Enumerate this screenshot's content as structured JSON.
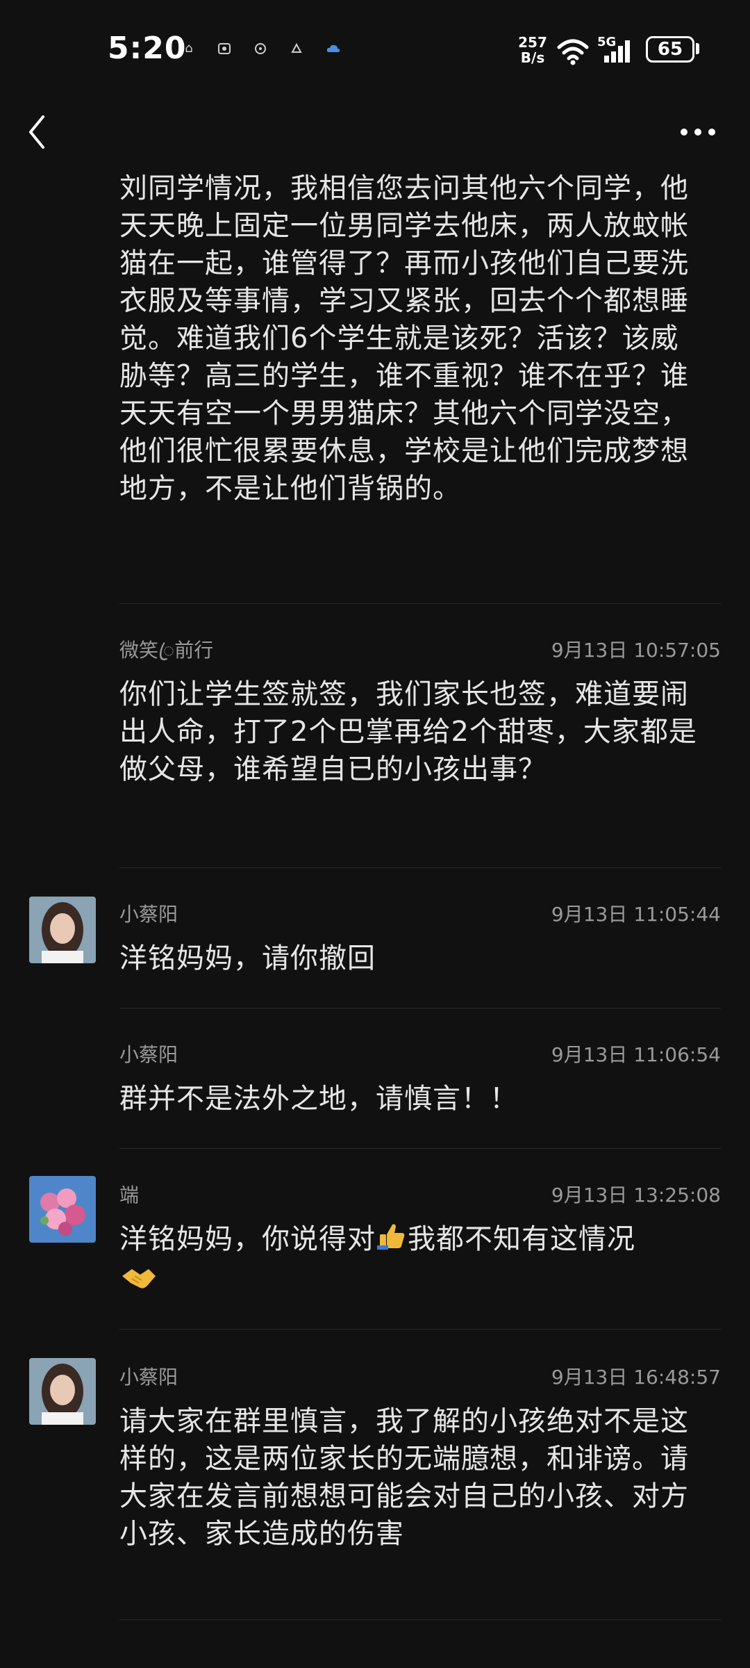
{
  "status": {
    "time": "5:20",
    "net_speed_value": "257",
    "net_speed_unit": "B/s",
    "network": "5G",
    "battery": "65",
    "icons": [
      "home-icon",
      "gallery-icon",
      "app-icon",
      "app-icon",
      "cloud-icon"
    ]
  },
  "nav": {
    "back_icon": "chevron-left-icon",
    "more_icon": "more-dots-icon"
  },
  "messages": [
    {
      "text": "刘同学情况，我相信您去问其他六个同学，他天天晚上固定一位男同学去他床，两人放蚊帐猫在一起，谁管得了？再而小孩他们自己要洗衣服及等事情，学习又紧张，回去个个都想睡觉。难道我们6个学生就是该死？活该？该威胁等？高三的学生，谁不重视？谁不在乎？谁天天有空一个男男猫床？其他六个同学没空，他们很忙很累要休息，学校是让他们完成梦想地方，不是让他们背锅的。"
    },
    {
      "sender": "微笑ꦿ前行",
      "time": "9月13日 10:57:05",
      "text": "你们让学生签就签，我们家长也签，难道要闹出人命，打了2个巴掌再给2个甜枣，大家都是做父母，谁希望自已的小孩出事？"
    },
    {
      "sender": "小蔡阳",
      "time": "9月13日 11:05:44",
      "text": "洋铭妈妈，请你撤回"
    },
    {
      "sender": "小蔡阳",
      "time": "9月13日 11:06:54",
      "text": "群并不是法外之地，请慎言！！"
    },
    {
      "sender": "端",
      "time": "9月13日 13:25:08",
      "text_a": "洋铭妈妈，你说得对",
      "emoji_a": "👍",
      "text_b": "我都不知有这情况",
      "emoji_b": "🤝"
    },
    {
      "sender": "小蔡阳",
      "time": "9月13日 16:48:57",
      "text": "请大家在群里慎言，我了解的小孩绝对不是这样的，这是两位家长的无端臆想，和诽谤。请大家在发言前想想可能会对自己的小孩、对方小孩、家长造成的伤害"
    }
  ],
  "colors": {
    "background": "#111111",
    "text": "#e6e6e6",
    "meta": "#9a9a9a",
    "divider": "#2b2b2b"
  }
}
